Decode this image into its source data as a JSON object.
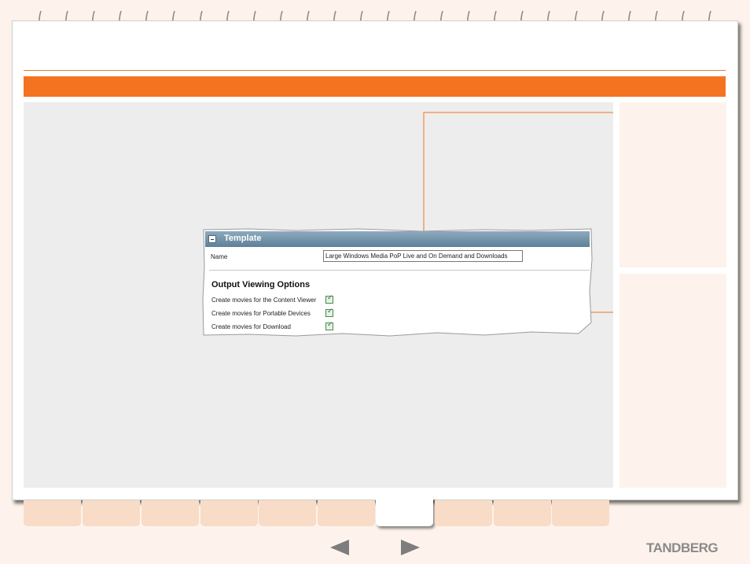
{
  "template_panel": {
    "title": "Template",
    "name_label": "Name",
    "name_value": "Large Windows Media PoP Live and On Demand and Downloads",
    "section_title": "Output Viewing Options",
    "options": [
      {
        "label": "Create movies for the Content Viewer",
        "checked": true
      },
      {
        "label": "Create movies for Portable Devices",
        "checked": true
      },
      {
        "label": "Create movies for Download",
        "checked": true
      }
    ]
  },
  "footer": {
    "brand": "TANDBERG",
    "prev_icon": "left-arrow-icon",
    "next_icon": "right-arrow-icon"
  },
  "colors": {
    "accent": "#f47321",
    "tab": "#f8dcc7",
    "background": "#fdf3ec"
  }
}
